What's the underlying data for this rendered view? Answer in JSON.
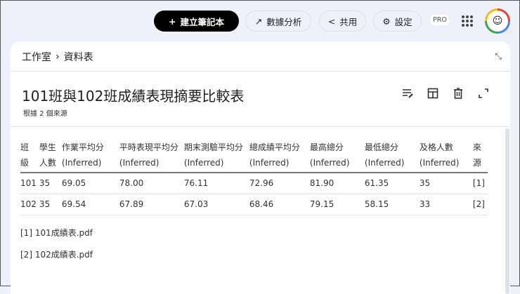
{
  "topbar": {
    "new_notebook": "建立筆記本",
    "analytics": "數據分析",
    "share": "共用",
    "settings": "設定",
    "pro": "PRO"
  },
  "breadcrumb": {
    "studio": "工作室",
    "current": "資料表"
  },
  "note": {
    "title": "101班與102班成績表現摘要比較表",
    "subtitle": "根據 2 個來源"
  },
  "table": {
    "headers": [
      [
        "班",
        "級"
      ],
      [
        "學生",
        "人數"
      ],
      [
        "作業平均分",
        "(Inferred)"
      ],
      [
        "平時表現平均分",
        "(Inferred)"
      ],
      [
        "期末測驗平均分",
        "(Inferred)"
      ],
      [
        "總成績平均分",
        "(Inferred)"
      ],
      [
        "最高總分",
        "(Inferred)"
      ],
      [
        "最低總分",
        "(Inferred)"
      ],
      [
        "及格人數",
        "(Inferred)"
      ],
      [
        "來",
        "源"
      ]
    ],
    "rows": [
      [
        "101",
        "35",
        "69.05",
        "78.00",
        "76.11",
        "72.96",
        "81.90",
        "61.35",
        "35",
        "[1]"
      ],
      [
        "102",
        "35",
        "69.54",
        "67.89",
        "67.03",
        "68.46",
        "79.15",
        "58.15",
        "33",
        "[2]"
      ]
    ]
  },
  "references": [
    "[1] 101成績表.pdf",
    "[2] 102成績表.pdf"
  ]
}
